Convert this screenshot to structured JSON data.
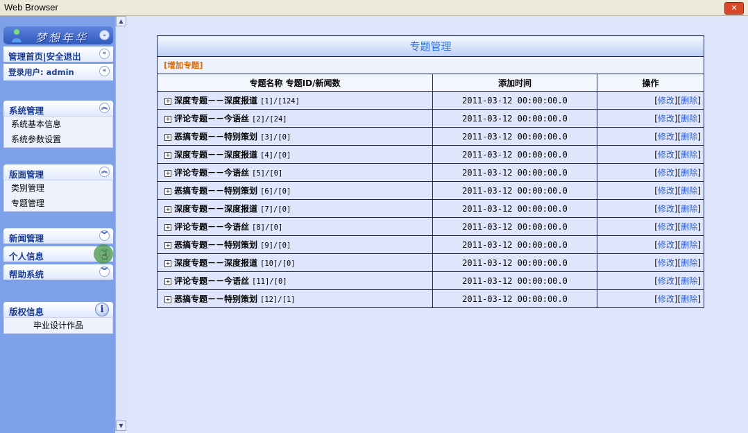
{
  "window": {
    "title": "Web Browser",
    "close_label": "✕"
  },
  "sidebar": {
    "logo_text": "梦想年华",
    "home_links": {
      "home": "管理首页",
      "sep": "|",
      "logout": "安全退出"
    },
    "login_user": "登录用户: admin",
    "panels": [
      {
        "title": "系统管理",
        "state": "expanded",
        "items": [
          "系统基本信息",
          "系统参数设置"
        ]
      },
      {
        "title": "版面管理",
        "state": "expanded",
        "items": [
          "类别管理",
          "专题管理"
        ]
      },
      {
        "title": "新闻管理",
        "state": "collapsed",
        "items": []
      },
      {
        "title": "个人信息",
        "state": "collapsed",
        "items": []
      },
      {
        "title": "帮助系统",
        "state": "collapsed",
        "items": []
      }
    ],
    "copyright": {
      "title": "版权信息",
      "text": "毕业设计作品"
    },
    "icons": {
      "collapse": "chevron-up-icon",
      "expand": "chevron-down-icon",
      "info": "info-icon"
    }
  },
  "main": {
    "title": "专题管理",
    "add_link": "[增加专题]",
    "columns": [
      "专题名称 专题ID/新闻数",
      "添加时间",
      "操作"
    ],
    "edit_label": "修改",
    "delete_label": "删除",
    "rows": [
      {
        "name": "深度专题－－深度报道",
        "id_count": "[1]/[124]",
        "time": "2011-03-12 00:00:00.0"
      },
      {
        "name": "评论专题－－今语丝",
        "id_count": "[2]/[24]",
        "time": "2011-03-12 00:00:00.0"
      },
      {
        "name": "恶搞专题－－特别策划",
        "id_count": "[3]/[0]",
        "time": "2011-03-12 00:00:00.0"
      },
      {
        "name": "深度专题－－深度报道",
        "id_count": "[4]/[0]",
        "time": "2011-03-12 00:00:00.0"
      },
      {
        "name": "评论专题－－今语丝",
        "id_count": "[5]/[0]",
        "time": "2011-03-12 00:00:00.0"
      },
      {
        "name": "恶搞专题－－特别策划",
        "id_count": "[6]/[0]",
        "time": "2011-03-12 00:00:00.0"
      },
      {
        "name": "深度专题－－深度报道",
        "id_count": "[7]/[0]",
        "time": "2011-03-12 00:00:00.0"
      },
      {
        "name": "评论专题－－今语丝",
        "id_count": "[8]/[0]",
        "time": "2011-03-12 00:00:00.0"
      },
      {
        "name": "恶搞专题－－特别策划",
        "id_count": "[9]/[0]",
        "time": "2011-03-12 00:00:00.0"
      },
      {
        "name": "深度专题－－深度报道",
        "id_count": "[10]/[0]",
        "time": "2011-03-12 00:00:00.0"
      },
      {
        "name": "评论专题－－今语丝",
        "id_count": "[11]/[0]",
        "time": "2011-03-12 00:00:00.0"
      },
      {
        "name": "恶搞专题－－特别策划",
        "id_count": "[12]/[1]",
        "time": "2011-03-12 00:00:00.0"
      }
    ]
  }
}
